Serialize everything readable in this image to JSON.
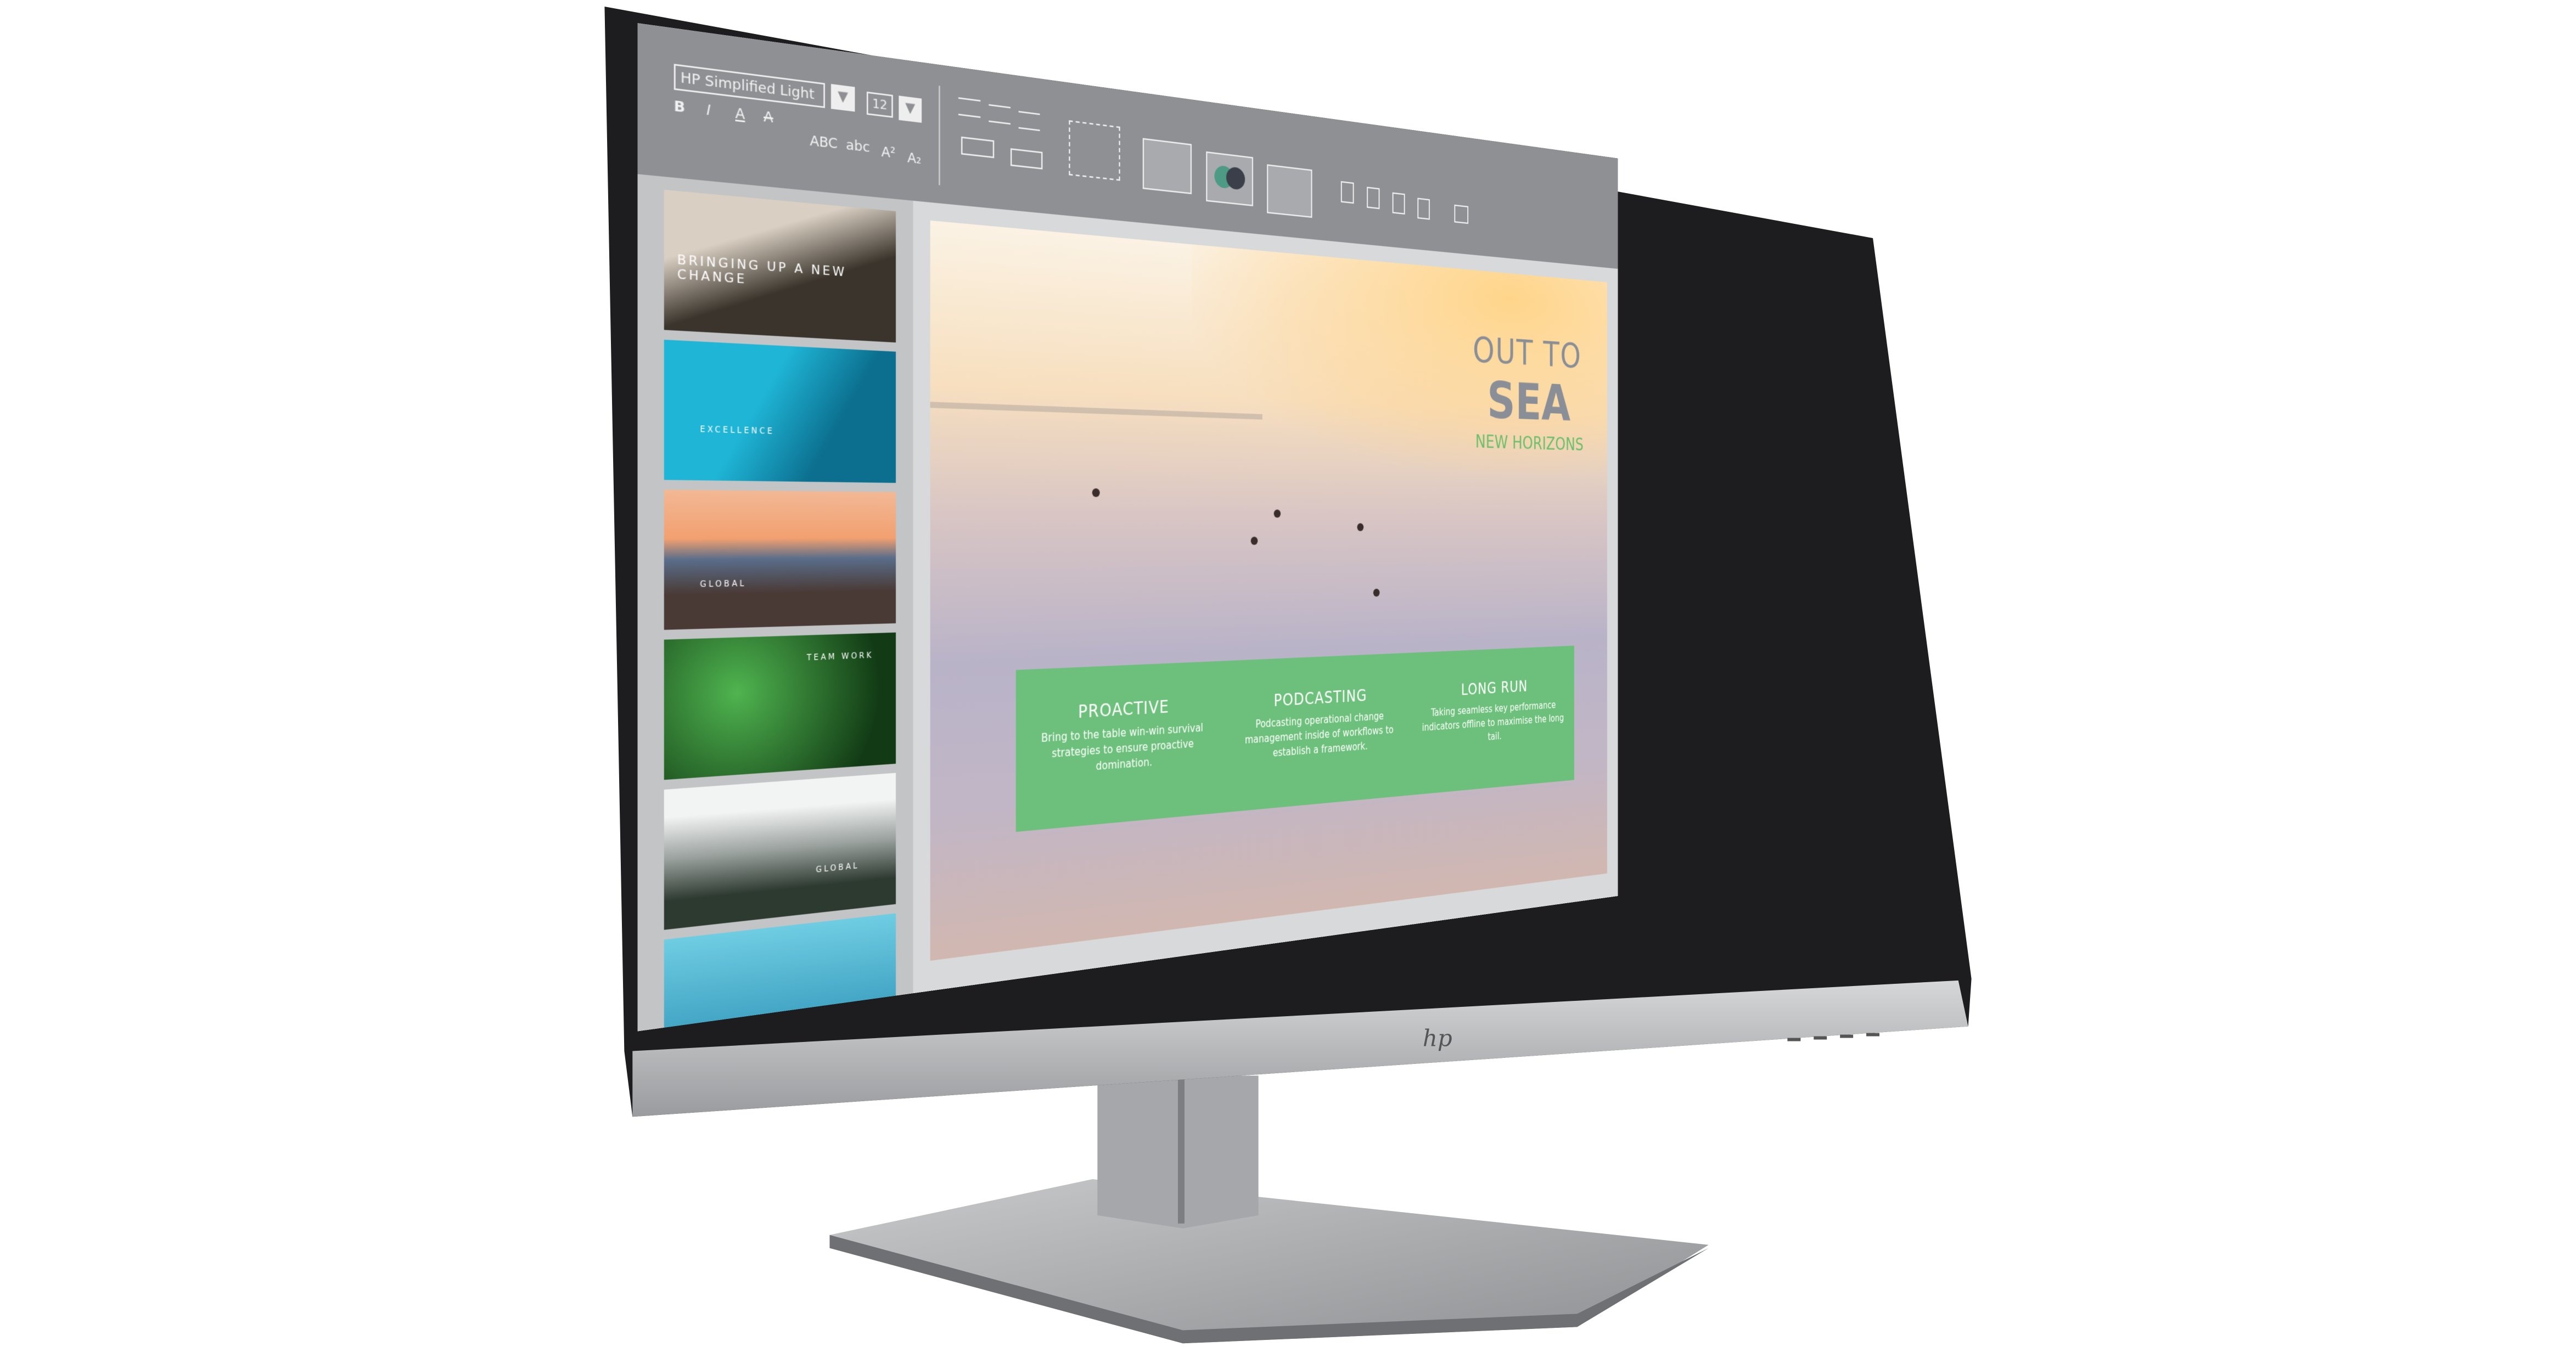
{
  "brand_logo": "hp",
  "toolbar": {
    "font_name": "HP Simplified Light",
    "font_size": "12",
    "bold": "B",
    "italic": "I",
    "underline": "A",
    "strike": "A",
    "uppercase": "ABC",
    "lowercase": "abc",
    "superscript": "A²",
    "subscript": "A₂",
    "icons": [
      "align-left-icon",
      "align-center-icon",
      "align-right-icon",
      "indent-icon",
      "outdent-icon",
      "layout-icon",
      "line-chart-icon",
      "venn-chart-icon",
      "scatter-chart-icon",
      "document-icon",
      "add-document-icon",
      "copy-icon",
      "page-icon",
      "image-icon"
    ]
  },
  "thumbnails": [
    {
      "title": "BRINGING UP A NEW CHANGE",
      "colors": [
        "#d9cfc2",
        "#3a342c"
      ]
    },
    {
      "title": "EXCELLENCE",
      "colors": [
        "#1fb5d6",
        "#0c6f8f"
      ]
    },
    {
      "title": "GLOBAL",
      "colors": [
        "#f2a070",
        "#4a3a36"
      ]
    },
    {
      "title": "TEAM WORK",
      "colors": [
        "#3c9a3c",
        "#123b15"
      ]
    },
    {
      "title": "GLOBAL",
      "colors": [
        "#e8eaea",
        "#2d3a30"
      ]
    },
    {
      "title": "",
      "colors": [
        "#6fcde2",
        "#2b8fb5"
      ]
    }
  ],
  "slide": {
    "title_line1": "OUT TO",
    "title_line2": "SEA",
    "subtitle": "NEW HORIZONS",
    "columns": [
      {
        "heading": "PROACTIVE",
        "body": "Bring to the table win-win survival strategies to ensure proactive domination."
      },
      {
        "heading": "PODCASTING",
        "body": "Podcasting operational change management inside of workflows to establish a framework."
      },
      {
        "heading": "LONG RUN",
        "body": "Taking seamless key performance indicators offline to maximise the long tail."
      }
    ],
    "accent": "#6dc07b"
  }
}
